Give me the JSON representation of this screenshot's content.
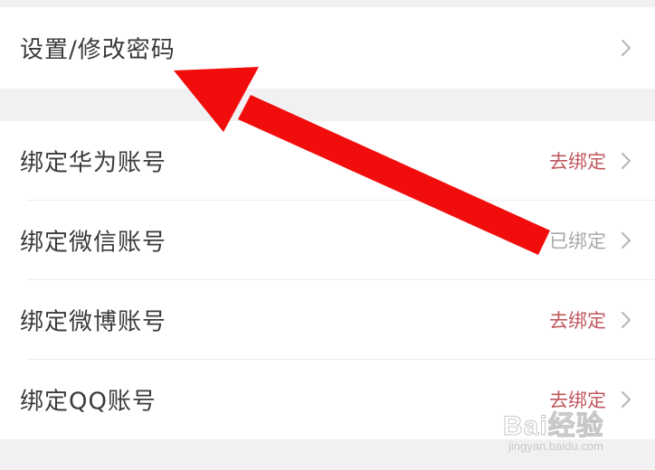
{
  "password_section": {
    "label": "设置/修改密码"
  },
  "bind_section": {
    "items": [
      {
        "label": "绑定华为账号",
        "status": "去绑定",
        "state": "unbound"
      },
      {
        "label": "绑定微信账号",
        "status": "已绑定",
        "state": "bound"
      },
      {
        "label": "绑定微博账号",
        "status": "去绑定",
        "state": "unbound"
      },
      {
        "label": "绑定QQ账号",
        "status": "去绑定",
        "state": "unbound"
      }
    ]
  },
  "colors": {
    "unbound_status": "#c0585e",
    "bound_status": "#a8a8a8",
    "annotation_arrow": "#f20d0d"
  },
  "icons": {
    "row_chevron": "chevron-right-icon",
    "annotation": "red-arrow-annotation"
  },
  "watermark": {
    "brand": "Bai经验",
    "site": "jingyan.baidu.com"
  }
}
